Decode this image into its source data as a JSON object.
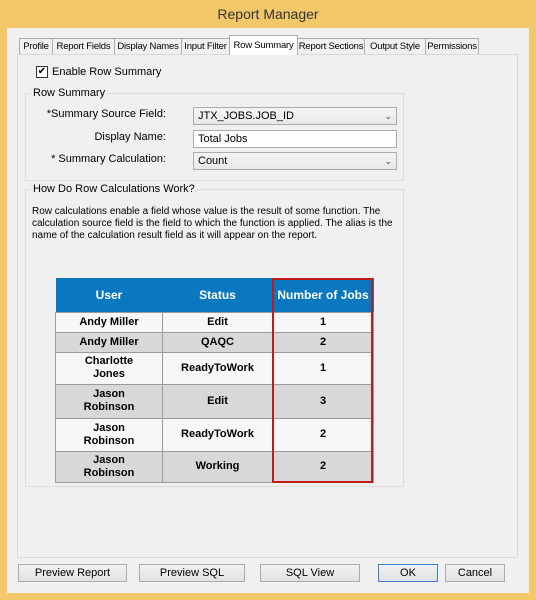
{
  "window": {
    "title": "Report Manager"
  },
  "tabs": [
    "Profile",
    "Report Fields",
    "Display Names",
    "Input Filter",
    "Row Summary",
    "Report Sections",
    "Output Style",
    "Permissions"
  ],
  "active_tab": "Row Summary",
  "enable_row_summary": {
    "label": "Enable Row Summary",
    "checked": true
  },
  "row_summary": {
    "title": "Row Summary",
    "source_label": "*Summary Source Field:",
    "source_value": "JTX_JOBS.JOB_ID",
    "display_label": "Display Name:",
    "display_value": "Total Jobs",
    "calc_label": "* Summary Calculation:",
    "calc_value": "Count"
  },
  "help": {
    "title": "How Do Row Calculations Work?",
    "text": "Row calculations enable a field whose value is the result of some function.  The calculation source field is the field to which the function is applied.  The alias is the name of the calculation result field as it will appear on the report.",
    "table": {
      "headers": [
        "User",
        "Status",
        "Number of Jobs"
      ],
      "rows": [
        [
          "Andy Miller",
          "Edit",
          "1"
        ],
        [
          "Andy Miller",
          "QAQC",
          "2"
        ],
        [
          "Charlotte Jones",
          "ReadyToWork",
          "1"
        ],
        [
          "Jason Robinson",
          "Edit",
          "3"
        ],
        [
          "Jason Robinson",
          "ReadyToWork",
          "2"
        ],
        [
          "Jason Robinson",
          "Working",
          "2"
        ]
      ],
      "header_color": "#0a78c0",
      "highlight_color": "#c41a1a"
    }
  },
  "buttons": {
    "preview_report": "Preview Report",
    "preview_sql": "Preview SQL",
    "sql_view": "SQL View",
    "ok": "OK",
    "cancel": "Cancel"
  }
}
